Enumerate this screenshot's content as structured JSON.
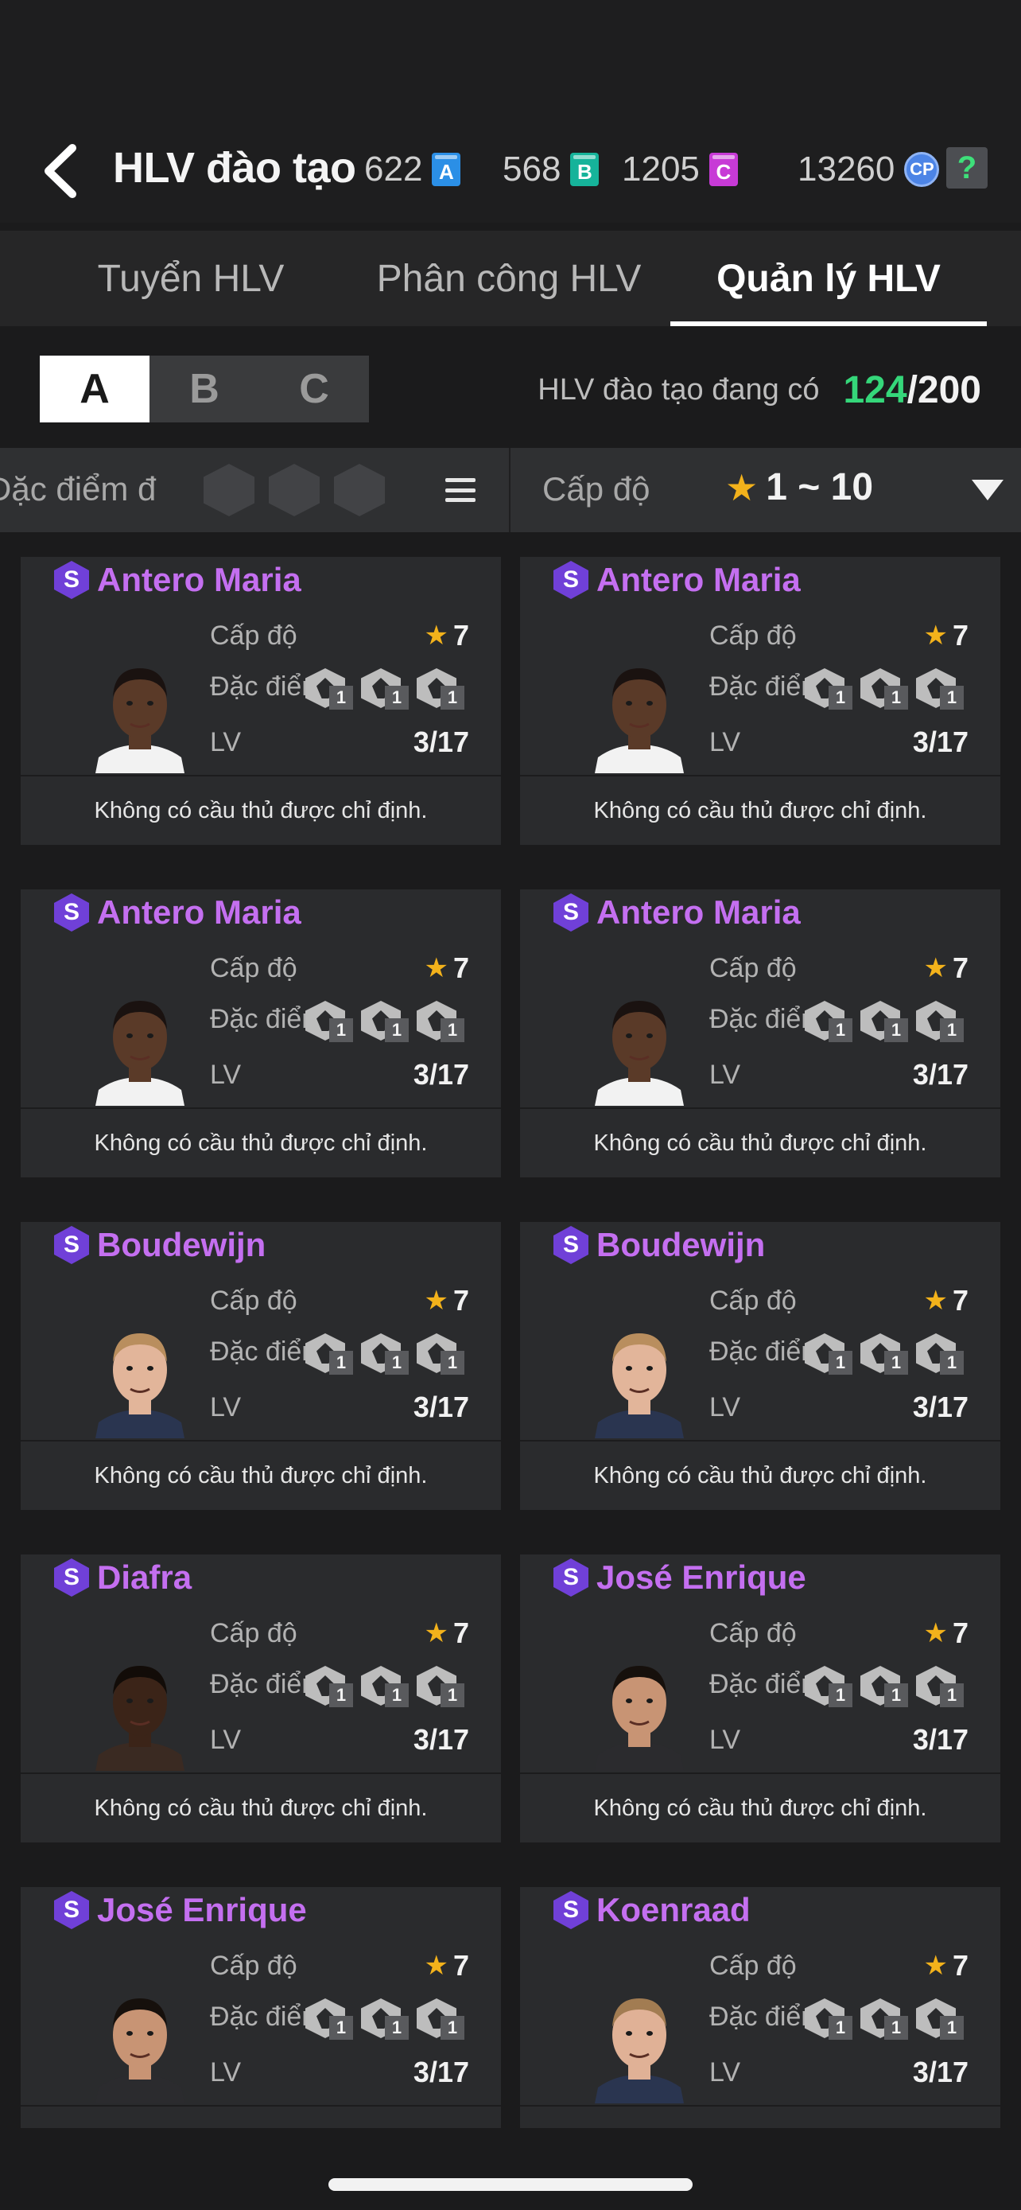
{
  "header": {
    "title": "HLV đào tạo",
    "currencies": [
      {
        "value": "622",
        "badge": "A",
        "color": "#2b8fe6"
      },
      {
        "value": "568",
        "badge": "B",
        "color": "#16b39a"
      },
      {
        "value": "1205",
        "badge": "C",
        "color": "#c73ad6"
      }
    ],
    "cp_value": "13260",
    "cp_label": "CP",
    "help_label": "?"
  },
  "tabs": [
    {
      "label": "Tuyển HLV",
      "active": false
    },
    {
      "label": "Phân công  HLV",
      "active": false
    },
    {
      "label": "Quản lý HLV",
      "active": true
    }
  ],
  "segments": [
    {
      "label": "A",
      "active": true
    },
    {
      "label": "B",
      "active": false
    },
    {
      "label": "C",
      "active": false
    }
  ],
  "owned": {
    "label": "HLV đào tạo đang có",
    "count": "124",
    "total": "/200"
  },
  "filters": {
    "trait_label": "Đặc điểm đ",
    "level_label": "Cấp độ",
    "level_range": "1 ~ 10"
  },
  "card_labels": {
    "level": "Cấp độ",
    "trait": "Đặc điểm",
    "lv": "LV",
    "no_player": "Không có cầu thủ được chỉ định.",
    "tier": "S"
  },
  "coaches": [
    {
      "name": "Antero Maria",
      "level": "7",
      "lv": "3/17",
      "traits": [
        "1",
        "1",
        "1"
      ],
      "skin": "#5a3a28",
      "hair": "#1a1210",
      "shirt": "#f2f2f2"
    },
    {
      "name": "Antero Maria",
      "level": "7",
      "lv": "3/17",
      "traits": [
        "1",
        "1",
        "1"
      ],
      "skin": "#5a3a28",
      "hair": "#1a1210",
      "shirt": "#f2f2f2"
    },
    {
      "name": "Antero Maria",
      "level": "7",
      "lv": "3/17",
      "traits": [
        "1",
        "1",
        "1"
      ],
      "skin": "#5a3a28",
      "hair": "#1a1210",
      "shirt": "#f2f2f2"
    },
    {
      "name": "Antero Maria",
      "level": "7",
      "lv": "3/17",
      "traits": [
        "1",
        "1",
        "1"
      ],
      "skin": "#5a3a28",
      "hair": "#1a1210",
      "shirt": "#f2f2f2"
    },
    {
      "name": "Boudewijn",
      "level": "7",
      "lv": "3/17",
      "traits": [
        "1",
        "1",
        "1"
      ],
      "skin": "#e2b59a",
      "hair": "#b98e5e",
      "shirt": "#2a3550"
    },
    {
      "name": "Boudewijn",
      "level": "7",
      "lv": "3/17",
      "traits": [
        "1",
        "1",
        "1"
      ],
      "skin": "#e2b59a",
      "hair": "#b98e5e",
      "shirt": "#2a3550"
    },
    {
      "name": "Diafra",
      "level": "7",
      "lv": "3/17",
      "traits": [
        "1",
        "1",
        "1"
      ],
      "skin": "#3b2418",
      "hair": "#120c08",
      "shirt": "#3a2a22"
    },
    {
      "name": "José Enrique",
      "level": "7",
      "lv": "3/17",
      "traits": [
        "1",
        "1",
        "1"
      ],
      "skin": "#c89474",
      "hair": "#16100c",
      "shirt": "#2b2b2e"
    },
    {
      "name": "José Enrique",
      "level": "7",
      "lv": "3/17",
      "traits": [
        "1",
        "1",
        "1"
      ],
      "skin": "#c89474",
      "hair": "#16100c",
      "shirt": "#2b2b2e"
    },
    {
      "name": "Koenraad",
      "level": "7",
      "lv": "3/17",
      "traits": [
        "1",
        "1",
        "1"
      ],
      "skin": "#e0b196",
      "hair": "#a27c52",
      "shirt": "#2a3550"
    }
  ]
}
